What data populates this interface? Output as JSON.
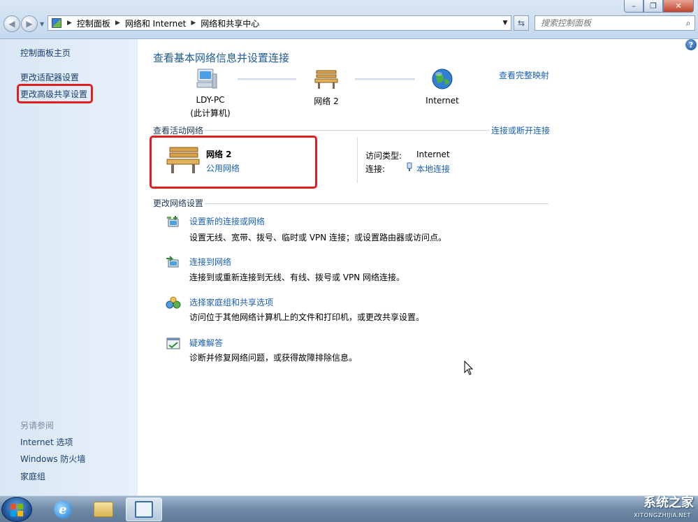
{
  "window": {
    "minimize_label": "–",
    "maximize_label": "❐",
    "close_label": "✕"
  },
  "address_bar": {
    "crumbs": [
      "控制面板",
      "网络和 Internet",
      "网络和共享中心"
    ],
    "search_placeholder": "搜索控制面板"
  },
  "left_pane": {
    "links": [
      "控制面板主页",
      "更改适配器设置",
      "更改高级共享设置"
    ],
    "see_also_title": "另请参阅",
    "see_also": [
      "Internet 选项",
      "Windows 防火墙",
      "家庭组"
    ]
  },
  "main": {
    "title": "查看基本网络信息并设置连接",
    "full_map_link": "查看完整映射",
    "map": {
      "computer_name": "LDY-PC",
      "computer_sub": "(此计算机)",
      "network_name": "网络  2",
      "internet_label": "Internet"
    },
    "active_section_title": "查看活动网络",
    "connect_disconnect_link": "连接或断开连接",
    "active_network": {
      "name": "网络  2",
      "type": "公用网络",
      "access_type_label": "访问类型:",
      "access_type_value": "Internet",
      "connections_label": "连接:",
      "connection_value": "本地连接"
    },
    "change_section_title": "更改网络设置",
    "tasks": [
      {
        "title": "设置新的连接或网络",
        "desc": "设置无线、宽带、拨号、临时或 VPN 连接；或设置路由器或访问点。"
      },
      {
        "title": "连接到网络",
        "desc": "连接到或重新连接到无线、有线、拨号或 VPN 网络连接。"
      },
      {
        "title": "选择家庭组和共享选项",
        "desc": "访问位于其他网络计算机上的文件和打印机，或更改共享设置。"
      },
      {
        "title": "疑难解答",
        "desc": "诊断并修复网络问题，或获得故障排除信息。"
      }
    ]
  },
  "watermark": {
    "text": "系统之家",
    "url": "XITONGZHIJIA.NET"
  },
  "colors": {
    "link": "#1a5fb4",
    "highlight_box": "#e02020",
    "title": "#1e5a9a"
  }
}
